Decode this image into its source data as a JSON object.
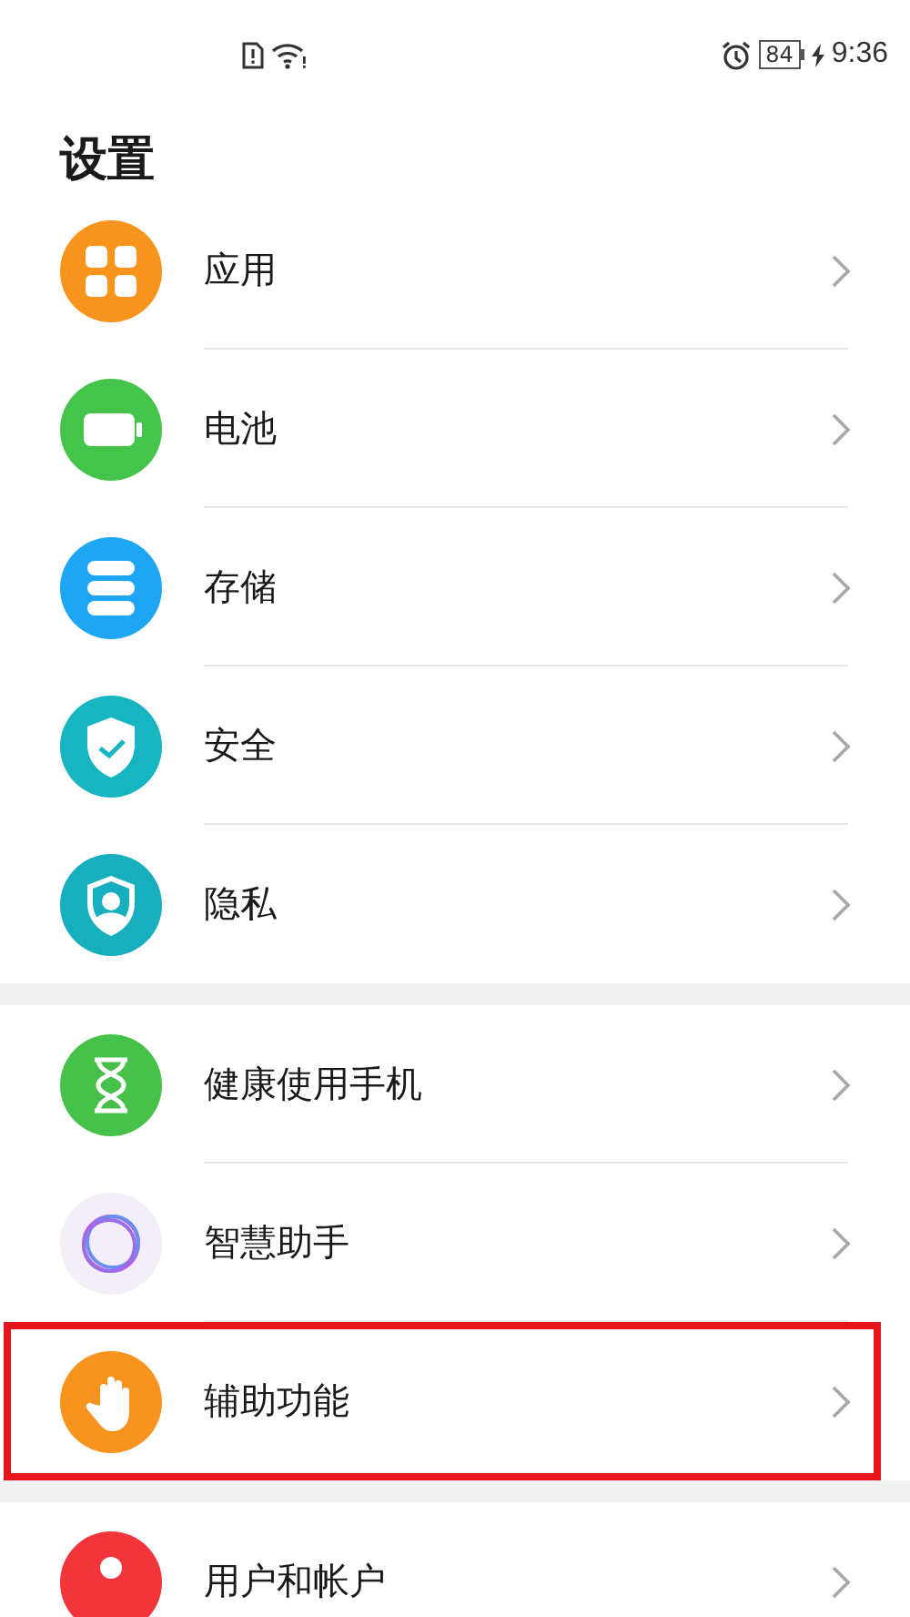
{
  "status_bar": {
    "battery": "84",
    "time": "9:36"
  },
  "title": "设置",
  "groups": [
    {
      "items": [
        {
          "label": "应用",
          "kind": "apps",
          "color": "#f7941d",
          "highlighted": false
        },
        {
          "label": "电池",
          "kind": "battery",
          "color": "#45c44b",
          "highlighted": false
        },
        {
          "label": "存储",
          "kind": "storage",
          "color": "#1ea6f4",
          "highlighted": false
        },
        {
          "label": "安全",
          "kind": "security",
          "color": "#17b4c2",
          "highlighted": false
        },
        {
          "label": "隐私",
          "kind": "privacy",
          "color": "#17afbd",
          "highlighted": false
        }
      ]
    },
    {
      "items": [
        {
          "label": "健康使用手机",
          "kind": "health",
          "color": "#46c24b",
          "highlighted": false
        },
        {
          "label": "智慧助手",
          "kind": "assistant",
          "color": "#f3eef8",
          "highlighted": false
        },
        {
          "label": "辅助功能",
          "kind": "accessibility",
          "color": "#f7931e",
          "highlighted": true
        }
      ]
    },
    {
      "items": [
        {
          "label": "用户和帐户",
          "kind": "user",
          "color": "#f2353a",
          "highlighted": false
        }
      ]
    }
  ]
}
